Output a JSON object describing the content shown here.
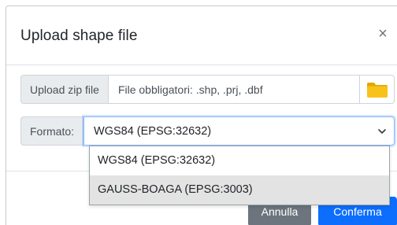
{
  "modal": {
    "title": "Upload shape file",
    "close_label": "×"
  },
  "upload": {
    "addon_label": "Upload zip file",
    "field_text": "File obbligatori: .shp, .prj, .dbf",
    "folder_icon": "folder-icon"
  },
  "format": {
    "addon_label": "Formato:",
    "selected_value": "WGS84 (EPSG:32632)",
    "options": [
      {
        "label": "WGS84 (EPSG:32632)"
      },
      {
        "label": "GAUSS-BOAGA (EPSG:3003)"
      }
    ]
  },
  "footer": {
    "cancel_label": "Annulla",
    "confirm_label": "Conferma"
  },
  "colors": {
    "primary": "#0d6efd",
    "secondary": "#6c757d",
    "folder": "#f4b400"
  }
}
